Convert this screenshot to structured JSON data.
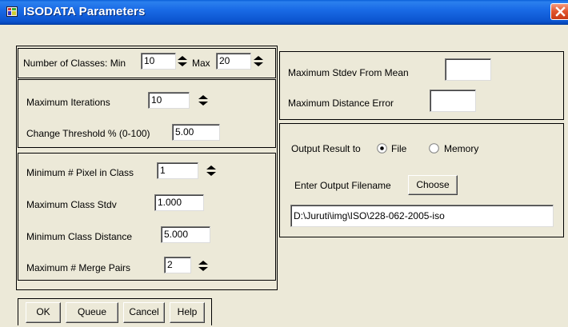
{
  "window": {
    "title": "ISODATA Parameters"
  },
  "classes": {
    "label": "Number of Classes: Min",
    "min_value": "10",
    "max_label": "Max",
    "max_value": "20"
  },
  "iterations": {
    "max_label": "Maximum Iterations",
    "max_value": "10",
    "threshold_label": "Change Threshold % (0-100)",
    "threshold_value": "5.00"
  },
  "merge": {
    "min_pixel_label": "Minimum # Pixel in Class",
    "min_pixel_value": "1",
    "max_stdv_label": "Maximum Class Stdv",
    "max_stdv_value": "1.000",
    "min_dist_label": "Minimum Class Distance",
    "min_dist_value": "5.000",
    "max_pairs_label": "Maximum # Merge Pairs",
    "max_pairs_value": "2"
  },
  "stdev": {
    "stdev_label": "Maximum Stdev From Mean",
    "stdev_value": "",
    "dist_error_label": "Maximum Distance Error",
    "dist_error_value": ""
  },
  "output": {
    "result_label": "Output Result to",
    "file_label": "File",
    "memory_label": "Memory",
    "selected": "File",
    "filename_label": "Enter Output Filename",
    "choose_label": "Choose",
    "filename_value": "D:\\Juruti\\img\\ISO\\228-062-2005-iso"
  },
  "buttons": {
    "ok": "OK",
    "queue": "Queue",
    "cancel": "Cancel",
    "help": "Help"
  }
}
